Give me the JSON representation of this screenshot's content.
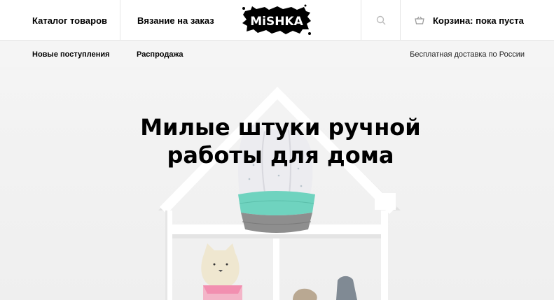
{
  "header": {
    "catalog_label": "Каталог товаров",
    "knitting_label": "Вязание на заказ",
    "logo_text": "MiSHKA",
    "search_icon": "search-icon",
    "cart_icon": "basket-icon",
    "cart_label": "Корзина: пока пуста"
  },
  "subnav": {
    "new_label": "Новые поступления",
    "sale_label": "Распродажа",
    "shipping_text": "Бесплатная доставка по России"
  },
  "hero": {
    "title_line1": "Милые штуки ручной",
    "title_line2": "работы для дома"
  },
  "colors": {
    "header_bg": "#ffffff",
    "subnav_bg": "#f5f5f5",
    "hero_bg": "#f2f2f2",
    "basket_mint": "#6fd3bf",
    "basket_grey": "#8e8e8e"
  }
}
